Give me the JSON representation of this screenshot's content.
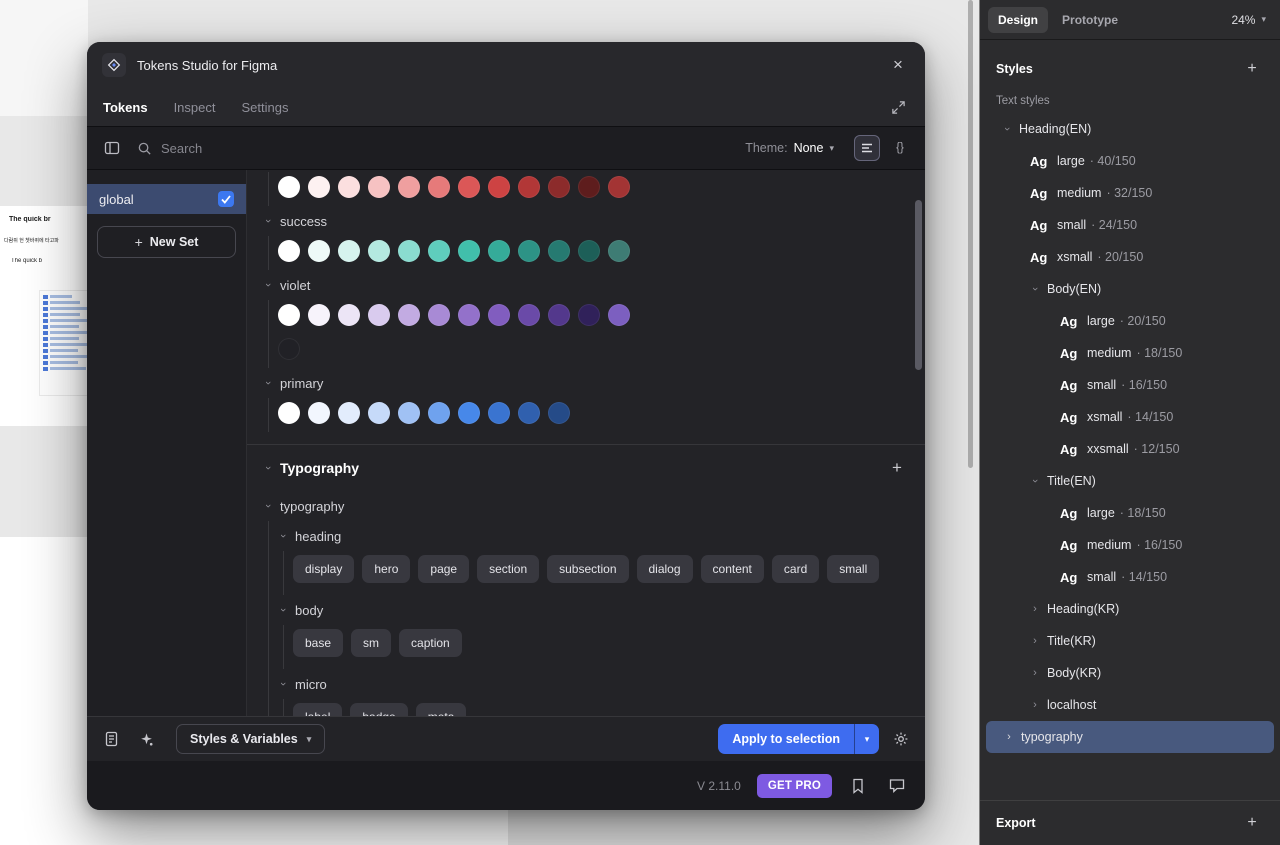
{
  "icons": {
    "close": "×",
    "caret_down": "▾",
    "chevron": "›",
    "plus": "+",
    "braces": "{}"
  },
  "canvas": {
    "texts": [
      "The quick br",
      "다람쥐 헌 쳇바퀴에 타고파",
      "The quick b"
    ]
  },
  "dialog": {
    "title": "Tokens Studio for Figma",
    "tabs": [
      {
        "label": "Tokens",
        "active": true
      },
      {
        "label": "Inspect",
        "active": false
      },
      {
        "label": "Settings",
        "active": false
      }
    ],
    "search": {
      "placeholder": "Search"
    },
    "theme": {
      "label": "Theme:",
      "value": "None"
    },
    "sets": {
      "items": [
        {
          "label": "global",
          "checked": true
        }
      ],
      "new_set_label": "New Set"
    },
    "token_groups": [
      {
        "name": "",
        "rows": [
          [
            "#ffffff",
            "#fdf1f1",
            "#fbdfdf",
            "#f6c2c2",
            "#ef9f9f",
            "#e67a7a",
            "#db5757",
            "#cd4343",
            "#b23737",
            "#8c2b2b",
            "#5e1d1d",
            "#a33434"
          ]
        ]
      },
      {
        "name": "success",
        "rows": [
          [
            "#ffffff",
            "#eefaf8",
            "#d6f3ee",
            "#b4e9e0",
            "#8adcd0",
            "#5fcdbd",
            "#41bfab",
            "#35ab99",
            "#2d9386",
            "#267a71",
            "#1d5f58",
            "#3e7c74"
          ]
        ]
      },
      {
        "name": "violet",
        "rows": [
          [
            "#ffffff",
            "#f7f3fb",
            "#ece5f6",
            "#d9cbee",
            "#c2abe2",
            "#a88ad5",
            "#9371ca",
            "#815dbf",
            "#6a4aa8",
            "#53388c",
            "#30215a",
            "#7c5fc0"
          ],
          [
            "#212126"
          ]
        ]
      },
      {
        "name": "primary",
        "rows": [
          [
            "#ffffff",
            "#f2f6fe",
            "#e2ecfc",
            "#c6daf9",
            "#a0c1f4",
            "#6fa2ee",
            "#4788e9",
            "#3a74d0",
            "#3060ae",
            "#254b88"
          ]
        ]
      }
    ],
    "typography": {
      "section_title": "Typography",
      "group_name": "typography",
      "subgroups": [
        {
          "name": "heading",
          "tokens": [
            "display",
            "hero",
            "page",
            "section",
            "subsection",
            "dialog",
            "content",
            "card",
            "small"
          ]
        },
        {
          "name": "body",
          "tokens": [
            "base",
            "sm",
            "caption"
          ]
        },
        {
          "name": "micro",
          "tokens": [
            "label",
            "badge",
            "meta"
          ]
        }
      ]
    },
    "footer": {
      "styles_variables": "Styles & Variables",
      "apply": "Apply to selection"
    },
    "bottom": {
      "version": "V 2.11.0",
      "get_pro": "GET PRO"
    }
  },
  "sidebar": {
    "tabs": [
      {
        "label": "Design",
        "active": true
      },
      {
        "label": "Prototype",
        "active": false
      }
    ],
    "zoom": "24%",
    "styles_header": "Styles",
    "text_styles_label": "Text styles",
    "export_header": "Export",
    "tree": [
      {
        "kind": "group",
        "label": "Heading(EN)",
        "indent": 1,
        "expanded": true
      },
      {
        "kind": "style",
        "preview": "Ag",
        "label": "large",
        "detail": "· 40/150",
        "indent": 2
      },
      {
        "kind": "style",
        "preview": "Ag",
        "label": "medium",
        "detail": "· 32/150",
        "indent": 2
      },
      {
        "kind": "style",
        "preview": "Ag",
        "label": "small",
        "detail": "· 24/150",
        "indent": 2
      },
      {
        "kind": "style",
        "preview": "Ag",
        "label": "xsmall",
        "detail": "· 20/150",
        "indent": 2
      },
      {
        "kind": "group",
        "label": "Body(EN)",
        "indent": 2,
        "expanded": true
      },
      {
        "kind": "style",
        "preview": "Ag",
        "label": "large",
        "detail": "· 20/150",
        "indent": 3
      },
      {
        "kind": "style",
        "preview": "Ag",
        "label": "medium",
        "detail": "· 18/150",
        "indent": 3
      },
      {
        "kind": "style",
        "preview": "Ag",
        "label": "small",
        "detail": "· 16/150",
        "indent": 3
      },
      {
        "kind": "style",
        "preview": "Ag",
        "label": "xsmall",
        "detail": "· 14/150",
        "indent": 3
      },
      {
        "kind": "style",
        "preview": "Ag",
        "label": "xxsmall",
        "detail": "· 12/150",
        "indent": 3
      },
      {
        "kind": "group",
        "label": "Title(EN)",
        "indent": 2,
        "expanded": true
      },
      {
        "kind": "style",
        "preview": "Ag",
        "label": "large",
        "detail": "· 18/150",
        "indent": 3
      },
      {
        "kind": "style",
        "preview": "Ag",
        "label": "medium",
        "detail": "· 16/150",
        "indent": 3
      },
      {
        "kind": "style",
        "preview": "Ag",
        "label": "small",
        "detail": "· 14/150",
        "indent": 3
      },
      {
        "kind": "group",
        "label": "Heading(KR)",
        "indent": 2,
        "expanded": false
      },
      {
        "kind": "group",
        "label": "Title(KR)",
        "indent": 2,
        "expanded": false
      },
      {
        "kind": "group",
        "label": "Body(KR)",
        "indent": 2,
        "expanded": false
      },
      {
        "kind": "group",
        "label": "localhost",
        "indent": 2,
        "expanded": false
      },
      {
        "kind": "group",
        "label": "typography",
        "indent": 1,
        "expanded": false,
        "selected": true
      }
    ]
  }
}
